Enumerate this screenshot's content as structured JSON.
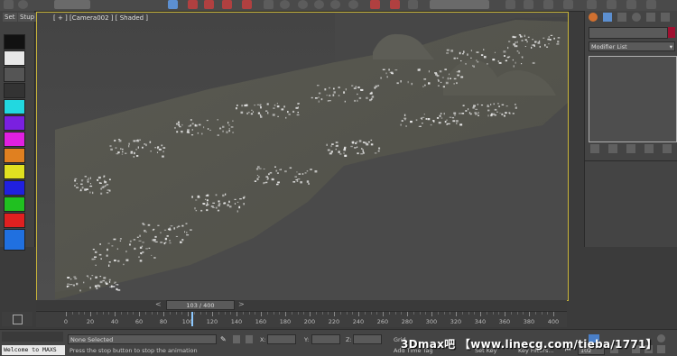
{
  "toolbar": {
    "icons": [
      "undo-icon",
      "redo-icon",
      "select-link-icon",
      "select-object-icon",
      "move-icon",
      "rotate-icon",
      "scale-icon",
      "render-setup-icon",
      "render-icon",
      "material-editor-icon"
    ]
  },
  "left_panel": {
    "tabs": [
      "Set",
      "Stup"
    ],
    "swatches": [
      "#111111",
      "#e8e8e8",
      "#555555",
      "#333333",
      "#22d8e0",
      "#7a20e0",
      "#e020e0",
      "#e08020",
      "#e0e020",
      "#2020e0",
      "#20c020",
      "#e02020",
      "#2070e0"
    ]
  },
  "viewport": {
    "label": "[ + ] [Camera002 ] [ Shaded ]"
  },
  "right_panel": {
    "modifier_list_label": "Modifier List",
    "icons": [
      "create-icon",
      "modify-icon",
      "hierarchy-icon",
      "motion-icon",
      "display-icon",
      "utilities-icon"
    ]
  },
  "timeline": {
    "frame_display": "103 / 400",
    "ticks": [
      "0",
      "20",
      "40",
      "60",
      "80",
      "100",
      "120",
      "140",
      "160",
      "180",
      "200",
      "220",
      "240",
      "260",
      "280",
      "300",
      "320",
      "340",
      "360",
      "380",
      "400"
    ],
    "current_frame": 103,
    "total_frames": 400
  },
  "statusbar": {
    "welcome": "Welcome to MAXS",
    "selection": "None Selected",
    "prompt": "Press the stop button to stop the animation",
    "x_label": "X:",
    "y_label": "Y:",
    "z_label": "Z:",
    "grid_label": "Grid",
    "add_time_tag": "Add Time Tag",
    "set_key": "Set Key",
    "key_filters": "Key Filters...",
    "frame_field": "102",
    "watermark": "3Dmax吧 【www.linecg.com/tieba/1771】"
  },
  "colors": {
    "viewport_border": "#c8b43a",
    "panel_bg": "#444444"
  }
}
